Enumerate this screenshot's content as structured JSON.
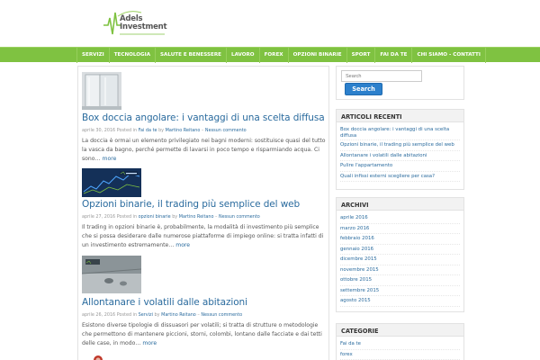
{
  "logo": {
    "line1": "Adels",
    "line2": "Investment"
  },
  "nav": [
    "SERVIZI",
    "TECNOLOGIA",
    "SALUTE E BENESSERE",
    "LAVORO",
    "FOREX",
    "OPZIONI BINARIE",
    "SPORT",
    "FAI DA TE",
    "CHI SIAMO - CONTATTI"
  ],
  "posts": [
    {
      "title": "Box doccia angolare: i vantaggi di una scelta diffusa",
      "meta_date": "aprile 30, 2016",
      "meta_posted": "Posted in",
      "meta_category": "Fai da te",
      "meta_by": "by",
      "meta_author": "Martino Reitano",
      "meta_sep": "–",
      "meta_comments": "Nessun commento",
      "excerpt": "La doccia è ormai un elemento privilegiato nei bagni moderni: sostituisce quasi del tutto la vasca da bagno, perché permette di lavarsi in poco tempo e risparmiando acqua. Ci sono…",
      "more": "more"
    },
    {
      "title": "Opzioni binarie, il trading più semplice del web",
      "meta_date": "aprile 27, 2016",
      "meta_posted": "Posted in",
      "meta_category": "opzioni binarie",
      "meta_by": "by",
      "meta_author": "Martino Reitano",
      "meta_sep": "–",
      "meta_comments": "Nessun commento",
      "excerpt": "Il trading in opzioni binarie è, probabilmente, la modalità di investimento più semplice che si possa desiderare dalle numerose piattaforme di impiego online: si tratta infatti di un investimento estremamente…",
      "more": "more"
    },
    {
      "title": "Allontanare i volatili dalle abitazioni",
      "meta_date": "aprile 26, 2016",
      "meta_posted": "Posted in",
      "meta_category": "Servizi",
      "meta_by": "by",
      "meta_author": "Martino Reitano",
      "meta_sep": "–",
      "meta_comments": "Nessun commento",
      "excerpt": "Esistono diverse tipologie di dissuasori per volatili; si tratta di strutture o metodologie che permettono di mantenere piccioni, storni, colombi, lontano dalle facciate e dai tetti delle case, in modo…",
      "more": "more"
    }
  ],
  "search": {
    "placeholder": "Search",
    "button": "Search"
  },
  "recent": {
    "title": "ARTICOLI RECENTI",
    "items": [
      "Box doccia angolare: i vantaggi di una scelta diffusa",
      "Opzioni binarie, il trading più semplice del web",
      "Allontanare i volatili dalle abitazioni",
      "Pulire l'appartamento",
      "Quali infissi esterni scegliere per casa?"
    ]
  },
  "archive": {
    "title": "ARCHIVI",
    "items": [
      "aprile 2016",
      "marzo 2016",
      "febbraio 2016",
      "gennaio 2016",
      "dicembre 2015",
      "novembre 2015",
      "ottobre 2015",
      "settembre 2015",
      "agosto 2015"
    ]
  },
  "categories": {
    "title": "CATEGORIE",
    "items": [
      "Fai da te",
      "forex"
    ]
  },
  "colors": {
    "nav_green": "#7fc241",
    "link_blue": "#2a6b9e",
    "button_blue": "#2c80cc"
  }
}
